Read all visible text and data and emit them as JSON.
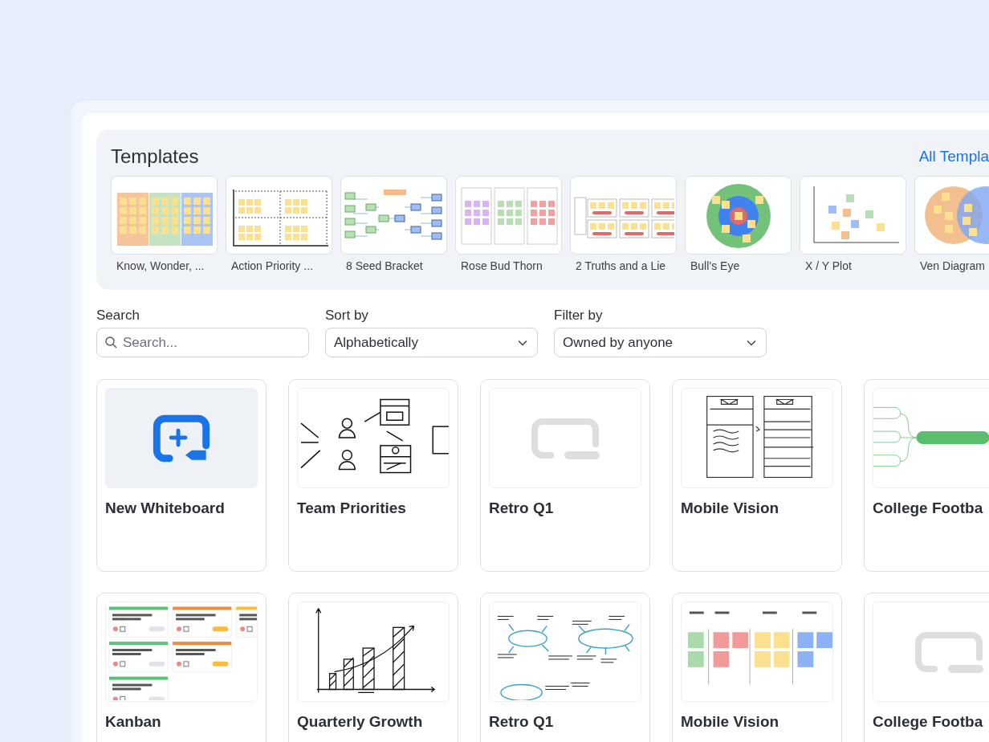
{
  "templates": {
    "title": "Templates",
    "link": "All Templa",
    "items": [
      {
        "label": "Know, Wonder, ...",
        "kind": "columns"
      },
      {
        "label": "Action Priority ...",
        "kind": "quadrant"
      },
      {
        "label": "8 Seed Bracket",
        "kind": "bracket"
      },
      {
        "label": "Rose Bud Thorn",
        "kind": "rose"
      },
      {
        "label": "2 Truths and a Lie",
        "kind": "truths"
      },
      {
        "label": "Bull’s Eye",
        "kind": "bullseye"
      },
      {
        "label": "X / Y Plot",
        "kind": "xyplot"
      },
      {
        "label": "Ven Diagram",
        "kind": "venn"
      }
    ]
  },
  "filters": {
    "search": {
      "label": "Search",
      "placeholder": "Search..."
    },
    "sort": {
      "label": "Sort by",
      "value": "Alphabetically"
    },
    "filter": {
      "label": "Filter by",
      "value": "Owned by anyone"
    }
  },
  "boards": [
    {
      "title": "New Whiteboard",
      "kind": "new"
    },
    {
      "title": "Team Priorities",
      "kind": "abtest"
    },
    {
      "title": "Retro Q1",
      "kind": "blank"
    },
    {
      "title": "Mobile Vision",
      "kind": "wireframe"
    },
    {
      "title": "College Footba",
      "kind": "mindmap"
    },
    {
      "title": "Kanban",
      "kind": "kanban"
    },
    {
      "title": "Quarterly Growth",
      "kind": "growth"
    },
    {
      "title": "Retro Q1",
      "kind": "sketchmap"
    },
    {
      "title": "Mobile Vision",
      "kind": "retro"
    },
    {
      "title": "College Footba",
      "kind": "blank"
    }
  ]
}
